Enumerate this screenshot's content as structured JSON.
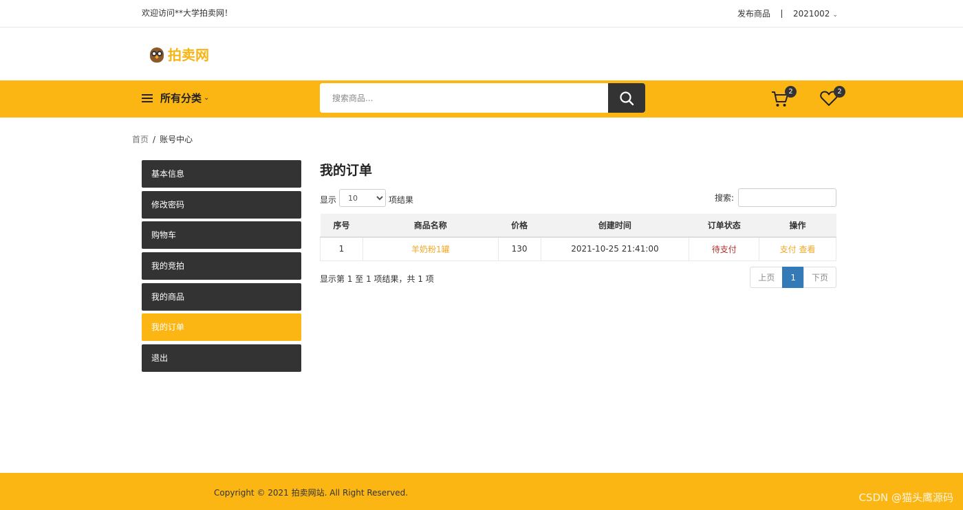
{
  "topbar": {
    "welcome": "欢迎访问**大学拍卖网！",
    "publish": "发布商品",
    "user": "2021002"
  },
  "logo": {
    "text": "拍卖网"
  },
  "nav": {
    "categories": "所有分类",
    "search_placeholder": "搜索商品...",
    "cart_count": "2",
    "wish_count": "2"
  },
  "breadcrumb": {
    "home": "首页",
    "current": "账号中心"
  },
  "sidebar": {
    "items": [
      {
        "label": "基本信息"
      },
      {
        "label": "修改密码"
      },
      {
        "label": "购物车"
      },
      {
        "label": "我的竞拍"
      },
      {
        "label": "我的商品"
      },
      {
        "label": "我的订单"
      },
      {
        "label": "退出"
      }
    ],
    "active": "我的订单"
  },
  "main": {
    "title": "我的订单",
    "show_label": "显示",
    "page_size": "10",
    "results_label": "项结果",
    "search_label": "搜索:",
    "columns": [
      "序号",
      "商品名称",
      "价格",
      "创建时间",
      "订单状态",
      "操作"
    ],
    "rows": [
      {
        "no": "1",
        "name": "羊奶粉1罐",
        "price": "130",
        "created": "2021-10-25 21:41:00",
        "status": "待支付",
        "pay": "支付",
        "view": "查看"
      }
    ],
    "info": "显示第 1 至 1 项结果，共 1 项",
    "pager": {
      "prev": "上页",
      "current": "1",
      "next": "下页"
    }
  },
  "footer": {
    "copyright": "Copyright © 2021 拍卖网站. All Right Reserved.",
    "watermark": "CSDN @猫头鹰源码"
  },
  "colors": {
    "accent": "#fbb614",
    "dark": "#333333",
    "link": "#f2a824",
    "pager_active": "#337ab7"
  }
}
